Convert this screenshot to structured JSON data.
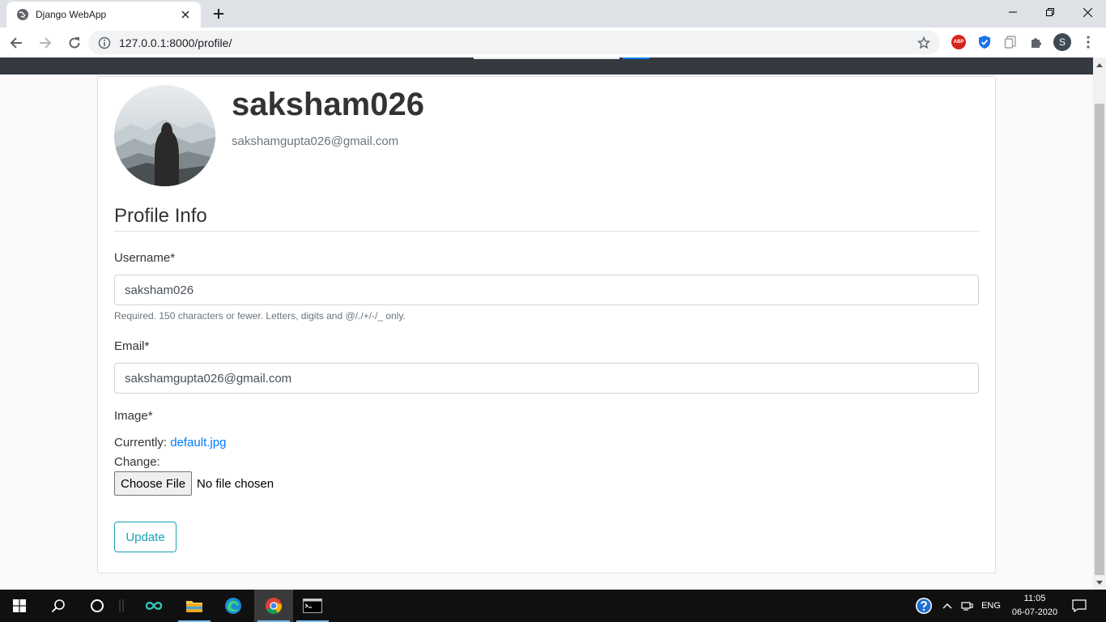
{
  "browser": {
    "tab_title": "Django WebApp",
    "url": "127.0.0.1:8000/profile/",
    "profile_initial": "S",
    "abp_label": "ABP"
  },
  "profile": {
    "username": "saksham026",
    "email": "sakshamgupta026@gmail.com",
    "section_title": "Profile Info"
  },
  "form": {
    "username_label": "Username*",
    "username_value": "saksham026",
    "username_help": "Required. 150 characters or fewer. Letters, digits and @/./+/-/_ only.",
    "email_label": "Email*",
    "email_value": "sakshamgupta026@gmail.com",
    "image_label": "Image*",
    "currently_label": "Currently:",
    "current_file": "default.jpg",
    "change_label": "Change:",
    "choose_file_label": "Choose File",
    "file_status": "No file chosen",
    "submit_label": "Update"
  },
  "taskbar": {
    "language": "ENG",
    "time": "11:05",
    "date": "06-07-2020"
  }
}
